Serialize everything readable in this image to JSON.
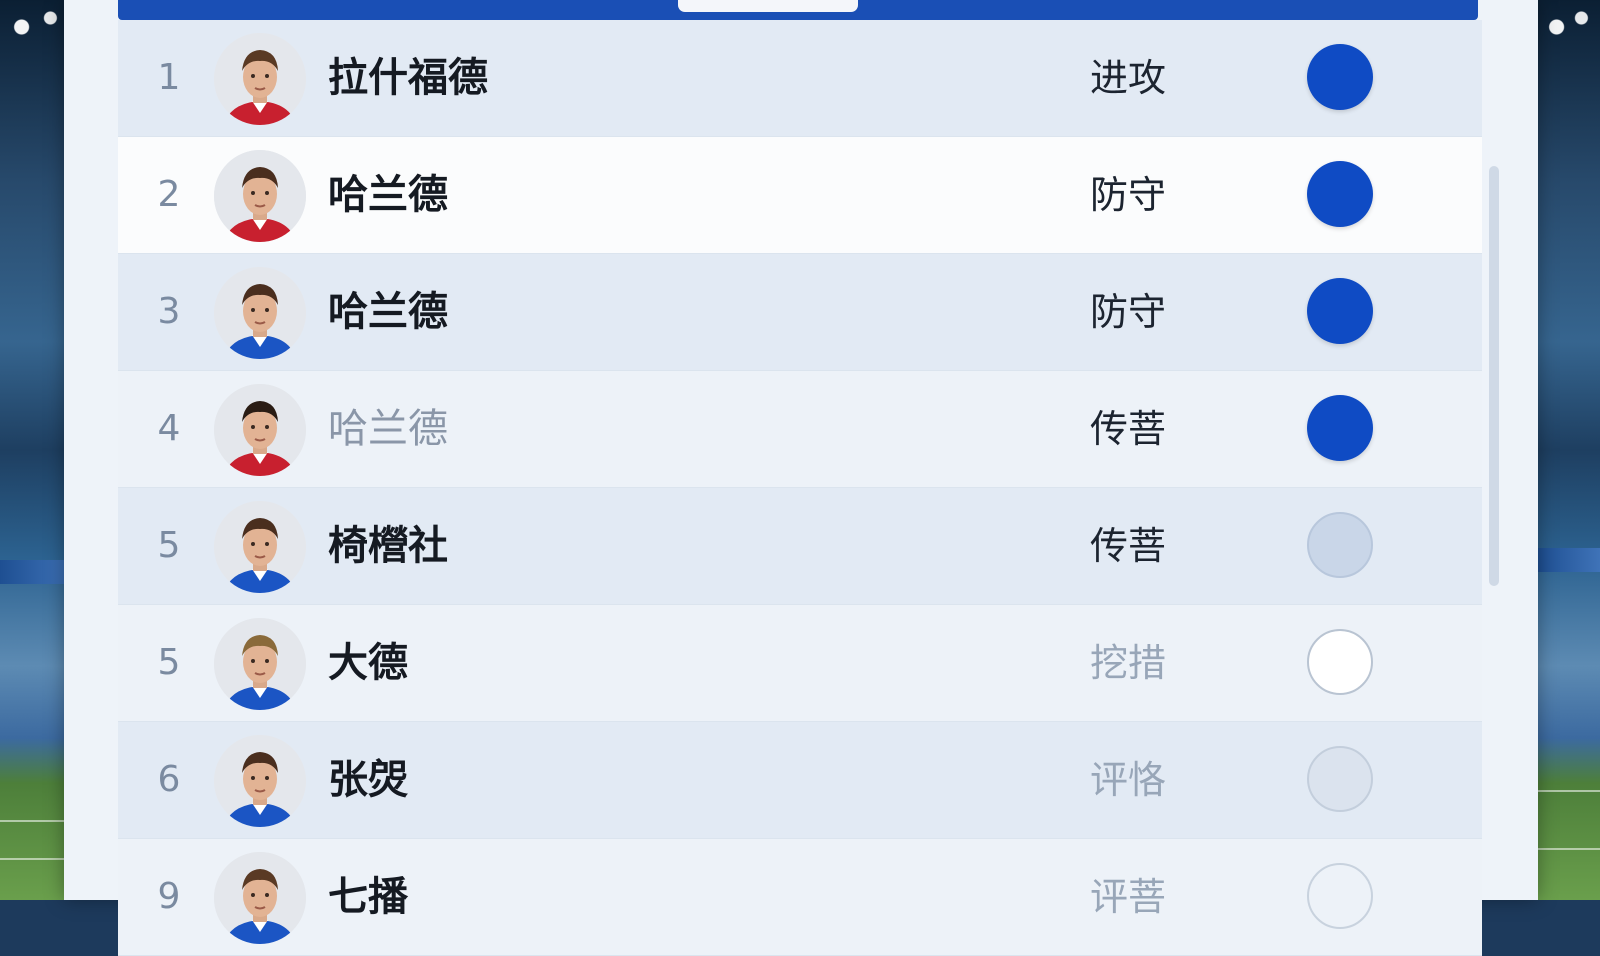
{
  "players": [
    {
      "rank": "1",
      "name": "拉什福德",
      "role": "进攻",
      "toggle": "on",
      "kit": "#c8202f",
      "hair": "#5a3a24",
      "row": "tint",
      "name_style": "",
      "role_style": ""
    },
    {
      "rank": "2",
      "name": "哈兰德",
      "role": "防守",
      "toggle": "on",
      "kit": "#c8202f",
      "hair": "#4a2e1e",
      "row": "white",
      "name_style": "",
      "role_style": ""
    },
    {
      "rank": "3",
      "name": "哈兰德",
      "role": "防守",
      "toggle": "on",
      "kit": "#1b55c4",
      "hair": "#4a2e1e",
      "row": "tint",
      "name_style": "",
      "role_style": ""
    },
    {
      "rank": "4",
      "name": "哈兰德",
      "role": "传菩",
      "toggle": "on",
      "kit": "#c8202f",
      "hair": "#2a1c14",
      "row": "light",
      "name_style": "faded",
      "role_style": ""
    },
    {
      "rank": "5",
      "name": "椅櫿社",
      "role": "传菩",
      "toggle": "mid",
      "kit": "#1b55c4",
      "hair": "#4a2e1e",
      "row": "tint",
      "name_style": "",
      "role_style": ""
    },
    {
      "rank": "5",
      "name": "大德",
      "role": "挖措",
      "toggle": "off",
      "kit": "#1b55c4",
      "hair": "#8a6a3a",
      "row": "light",
      "name_style": "",
      "role_style": "faded"
    },
    {
      "rank": "6",
      "name": "张焈",
      "role": "评恪",
      "toggle": "pale",
      "kit": "#1b55c4",
      "hair": "#4a2e1e",
      "row": "tint",
      "name_style": "",
      "role_style": "faded"
    },
    {
      "rank": "9",
      "name": "七播",
      "role": "评菩",
      "toggle": "ghost",
      "kit": "#1b55c4",
      "hair": "#5a3a24",
      "row": "light",
      "name_style": "",
      "role_style": "faded"
    }
  ],
  "colors": {
    "accent": "#1a4fb5",
    "toggle_on": "#0f4bc4"
  }
}
